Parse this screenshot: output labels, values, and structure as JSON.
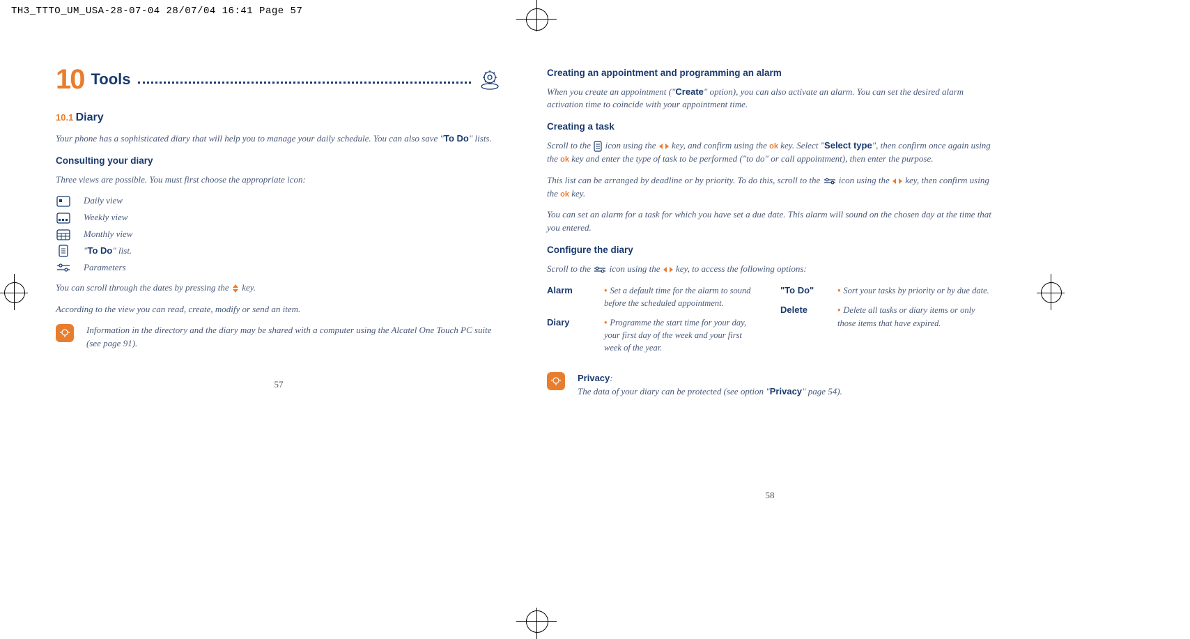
{
  "print_header": "TH3_TTTO_UM_USA-28-07-04  28/07/04  16:41  Page 57",
  "left": {
    "chapter_num": "10",
    "chapter_title": "Tools",
    "section_num": "10.1",
    "section_title": "Diary",
    "intro_a": "Your phone has a sophisticated diary that will help you to manage your daily schedule. You can also save \"",
    "intro_bold": "To Do",
    "intro_b": "\" lists.",
    "h_consult": "Consulting your diary",
    "consult_intro": "Three views are possible. You must first choose the appropriate icon:",
    "views": {
      "daily": "Daily view",
      "weekly": "Weekly view",
      "monthly": "Monthly view",
      "todo_a": "\"",
      "todo_bold": "To Do",
      "todo_b": "\" list.",
      "params": "Parameters"
    },
    "scroll_a": "You can scroll through the dates by pressing the ",
    "scroll_b": " key.",
    "according": "According to the view you can read, create, modify or send an item.",
    "info": "Information in the directory and the diary may be shared with a computer using the Alcatel One Touch PC suite (see page 91).",
    "pagenum": "57"
  },
  "right": {
    "h_create": "Creating an appointment and programming an alarm",
    "create_a": "When you create an appointment (\"",
    "create_bold": "Create",
    "create_b": "\" option), you can also activate an alarm. You can set the desired alarm activation time to coincide with your appointment time.",
    "h_task": "Creating a task",
    "task1_a": "Scroll to the ",
    "task1_b": " icon using the ",
    "task1_c": " key, and confirm using the ",
    "task1_d": " key. Select \"",
    "task1_bold": "Select type",
    "task1_e": "\", then confirm once again using the ",
    "task1_f": " key and enter the type of task to be performed (\"to do\" or call appointment), then enter the purpose.",
    "task2_a": "This list can be arranged by deadline or by priority. To do this, scroll to the ",
    "task2_b": " icon using the ",
    "task2_c": " key, then confirm using the ",
    "task2_d": " key.",
    "task3": "You can set an alarm for a task for which you have set a due date. This alarm will sound on the chosen day at the time that you entered.",
    "h_config": "Configure the diary",
    "config_intro_a": "Scroll to the ",
    "config_intro_b": " icon using the ",
    "config_intro_c": " key, to access the following options:",
    "config": {
      "alarm_label": "Alarm",
      "alarm_desc": "Set a default time for the alarm to sound before the scheduled appointment.",
      "diary_label": "Diary",
      "diary_desc": "Programme the start time for your day, your first day of the week and your first week of the year.",
      "todo_label": "\"To Do\"",
      "todo_desc": "Sort your tasks by priority or by due date.",
      "delete_label": "Delete",
      "delete_desc": "Delete all tasks or diary items or only those items that have expired."
    },
    "privacy_label": "Privacy",
    "privacy_a": "The data of your diary can be protected (see option \"",
    "privacy_bold": "Privacy",
    "privacy_b": "\" page 54).",
    "pagenum": "58",
    "ok_label": "ok"
  }
}
